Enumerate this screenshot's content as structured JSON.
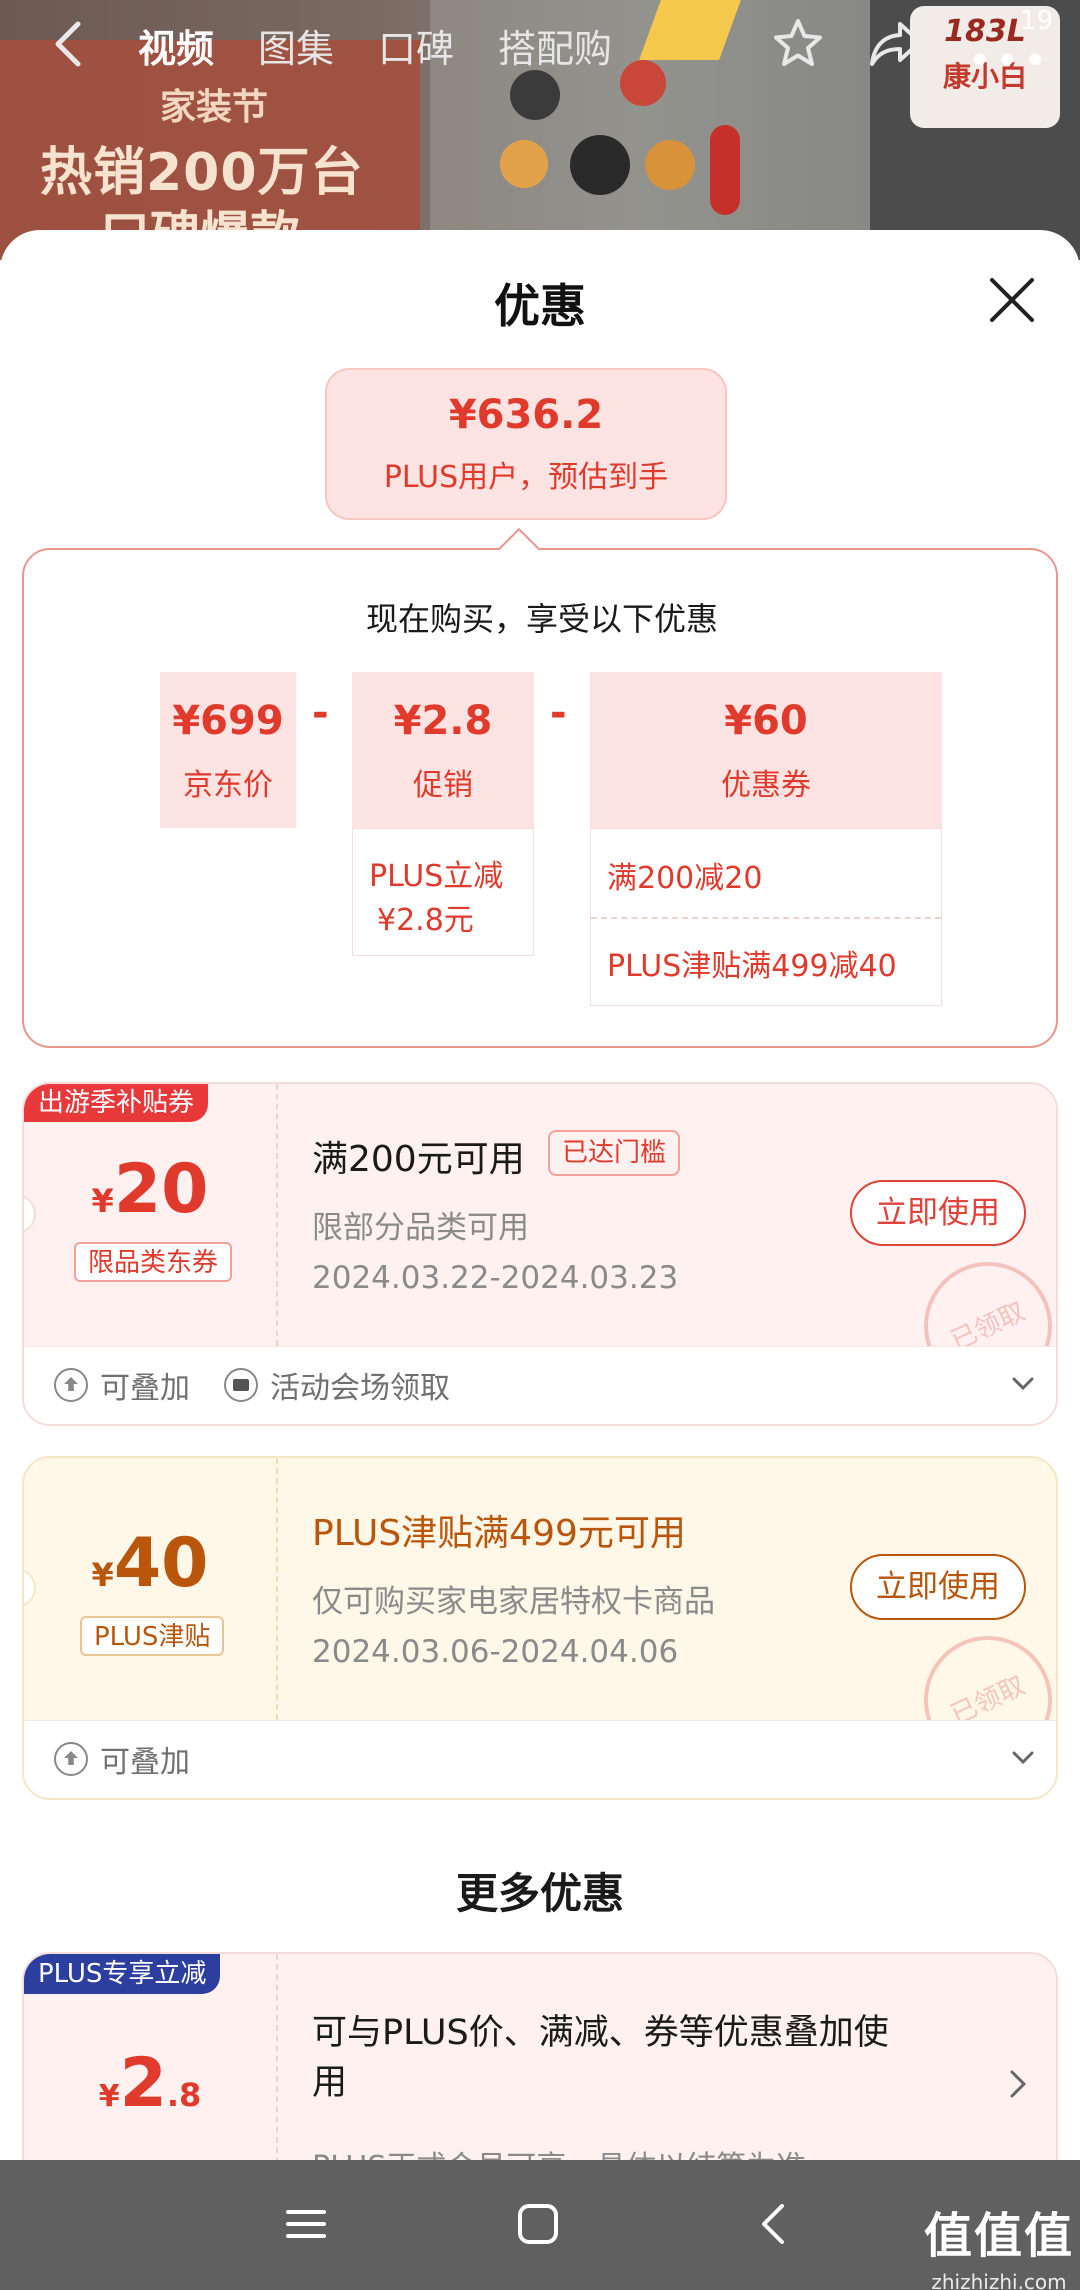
{
  "nav": {
    "tabs": [
      "视频",
      "图集",
      "口碑",
      "搭配购"
    ],
    "badge_count": "19"
  },
  "promo": {
    "festival": "家装节",
    "line1": "热销200万台",
    "line2": "口碑爆款"
  },
  "brand": {
    "top": "183L",
    "name": "康小白"
  },
  "sheet": {
    "title": "优惠",
    "final_price": "¥636.2",
    "final_sub": "PLUS用户，预估到手",
    "headline": "现在购买，享受以下优惠",
    "breakdown": [
      {
        "value": "¥699",
        "label": "京东价"
      },
      {
        "value": "¥2.8",
        "label": "促销"
      },
      {
        "value": "¥60",
        "label": "优惠券"
      }
    ],
    "minus": "-",
    "promo_detail": [
      "PLUS立减",
      "¥2.8元"
    ],
    "coupon_detail": [
      "满200减20",
      "PLUS津贴满499减40"
    ]
  },
  "coupons": [
    {
      "ribbon": "出游季补贴券",
      "currency": "¥",
      "amount": "20",
      "tag": "限品类东券",
      "title": "满200元可用",
      "reached": "已达门槛",
      "desc": "限部分品类可用",
      "date": "2024.03.22-2024.03.23",
      "use": "立即使用",
      "stamp": "已领取",
      "foot1": "可叠加",
      "foot2": "活动会场领取"
    },
    {
      "currency": "¥",
      "amount": "40",
      "tag": "PLUS津贴",
      "title": "PLUS津贴满499元可用",
      "desc": "仅可购买家电家居特权卡商品",
      "date": "2024.03.06-2024.04.06",
      "use": "立即使用",
      "stamp": "已领取",
      "foot1": "可叠加"
    }
  ],
  "more": {
    "title": "更多优惠",
    "ribbon": "PLUS专享立减",
    "currency": "¥",
    "amount": "2",
    "decimal": ".8",
    "text1": "可与PLUS价、满减、券等优惠叠加使用",
    "text2": "PLUS正式会员可享，具体以结算为准"
  },
  "watermark": {
    "brand": "值值值",
    "url": "zhizhizhi.com"
  },
  "colors": {
    "accent": "#e03a2c",
    "gold": "#b9560b",
    "plus_blue": "#2c3f9e"
  }
}
